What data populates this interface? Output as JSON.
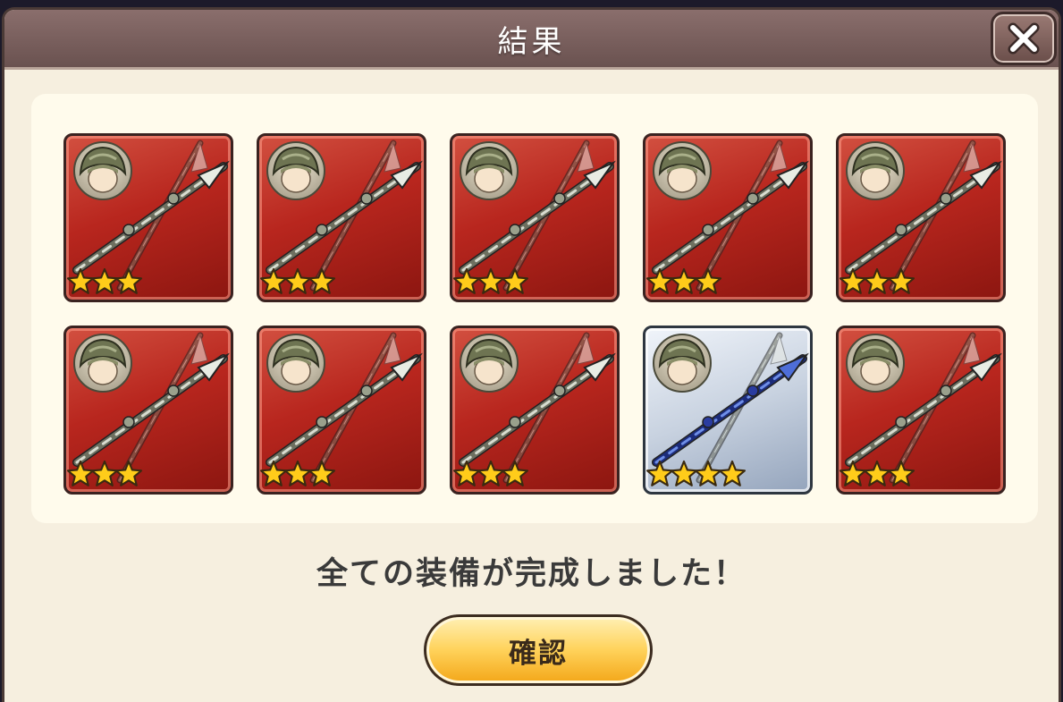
{
  "dialog": {
    "title": "結果",
    "close_icon": "close-icon",
    "message": "全ての装備が完成しました！",
    "confirm_label": "確認"
  },
  "colors": {
    "rarity3_bg": "#b8261e",
    "rarity4_bg": "#c8d2e0",
    "star": "#ffcc1a",
    "button": "#ffd25a"
  },
  "items": [
    {
      "icon": "silver-spear-icon",
      "rarity": 3
    },
    {
      "icon": "silver-spear-icon",
      "rarity": 3
    },
    {
      "icon": "silver-spear-icon",
      "rarity": 3
    },
    {
      "icon": "silver-spear-icon",
      "rarity": 3
    },
    {
      "icon": "silver-spear-icon",
      "rarity": 3
    },
    {
      "icon": "silver-spear-icon",
      "rarity": 3
    },
    {
      "icon": "silver-spear-icon",
      "rarity": 3
    },
    {
      "icon": "silver-spear-icon",
      "rarity": 3
    },
    {
      "icon": "blue-spear-icon",
      "rarity": 4
    },
    {
      "icon": "silver-spear-icon",
      "rarity": 3
    }
  ]
}
